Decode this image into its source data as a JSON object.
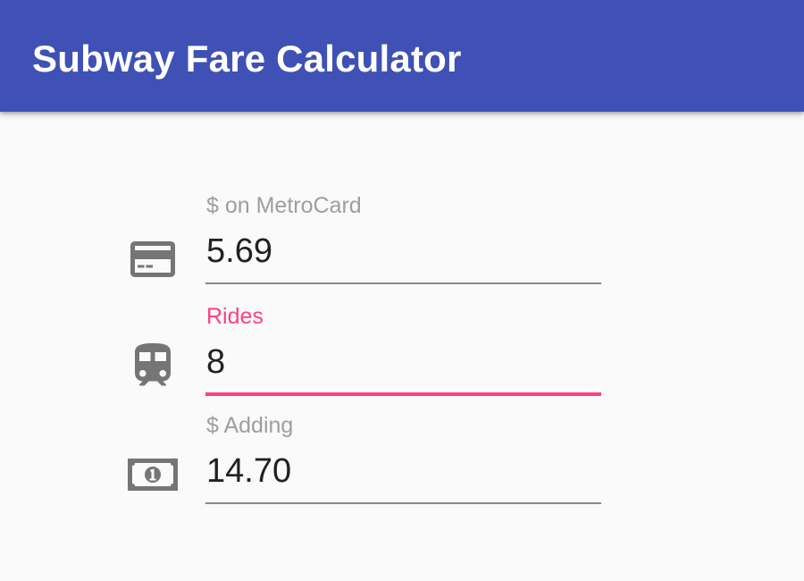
{
  "app": {
    "title": "Subway Fare Calculator"
  },
  "colors": {
    "primary": "#3f51b5",
    "accent": "#ff4081",
    "icon": "#757575"
  },
  "fields": {
    "metrocard": {
      "label": "$ on MetroCard",
      "value": "5.69",
      "icon": "credit-card-icon"
    },
    "rides": {
      "label": "Rides",
      "value": "8",
      "icon": "subway-train-icon",
      "focused": true
    },
    "adding": {
      "label": "$ Adding",
      "value": "14.70",
      "icon": "money-bill-icon"
    }
  }
}
